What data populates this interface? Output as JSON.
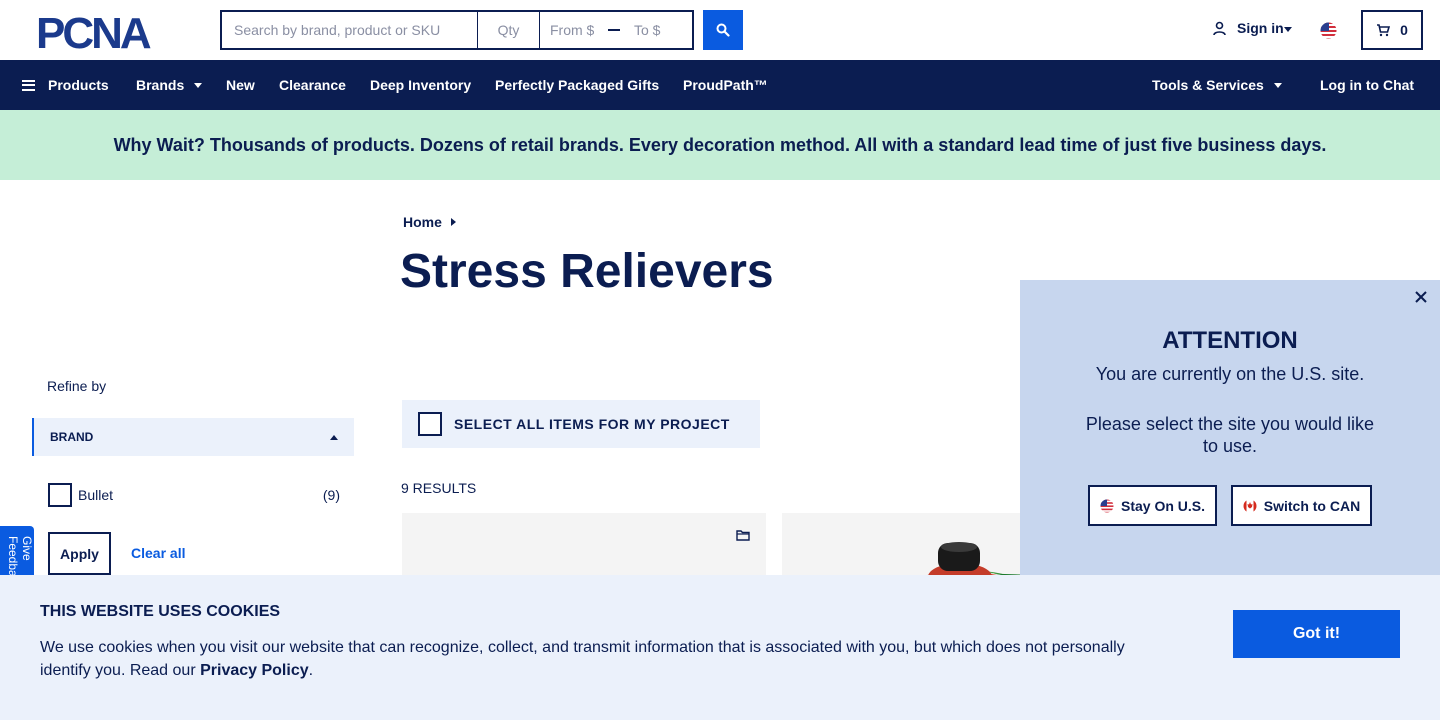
{
  "header": {
    "logo_text": "PCNA",
    "search": {
      "placeholder": "Search by brand, product or SKU",
      "value": ""
    },
    "qty": {
      "placeholder": "Qty",
      "value": ""
    },
    "price_from": {
      "placeholder": "From $",
      "value": ""
    },
    "price_to": {
      "placeholder": "To $",
      "value": ""
    },
    "sign_in_label": "Sign in",
    "cart_count": "0"
  },
  "nav": {
    "items": [
      {
        "label": "Products",
        "icon": "menu-icon"
      },
      {
        "label": "Brands",
        "icon": "chevron-down-icon"
      },
      {
        "label": "New"
      },
      {
        "label": "Clearance"
      },
      {
        "label": "Deep Inventory"
      },
      {
        "label": "Perfectly Packaged Gifts"
      },
      {
        "label": "ProudPath™"
      },
      {
        "label": "Tools & Services",
        "icon": "chevron-down-icon"
      },
      {
        "label": "Log in to Chat"
      }
    ]
  },
  "promo": {
    "text": "Why Wait? Thousands of products. Dozens of retail brands. Every decoration method. All with a standard lead time of just five business days."
  },
  "breadcrumb": {
    "home": "Home"
  },
  "page": {
    "title": "Stress Relievers"
  },
  "sidebar": {
    "refine_label": "Refine by",
    "facet": {
      "title": "BRAND",
      "options": [
        {
          "label": "Bullet",
          "count": "(9)",
          "checked": false
        }
      ]
    },
    "apply_label": "Apply",
    "clear_label": "Clear all",
    "feedback_label": "Give Feedback"
  },
  "main": {
    "select_all_label": "SELECT ALL ITEMS FOR MY PROJECT",
    "results_label": "9 RESULTS"
  },
  "modal": {
    "title": "ATTENTION",
    "line1": "You are currently on the U.S. site.",
    "line2": "Please select the site you would like to use.",
    "stay_label": "Stay On U.S.",
    "switch_label": "Switch to CAN"
  },
  "cookie": {
    "title": "THIS WEBSITE USES COOKIES",
    "text": "We use cookies when you visit our website that can recognize, collect, and transmit information that is associated with you, but which does not personally identify you. Read our ",
    "link_label": "Privacy Policy",
    "text_end": ".",
    "button_label": "Got it!"
  },
  "colors": {
    "navy": "#0b1d51",
    "brand_blue": "#0a5be0",
    "promo_green": "#c5eed7",
    "light_blue_bg": "#ebf1fb",
    "modal_bg": "#c7d6ee"
  }
}
